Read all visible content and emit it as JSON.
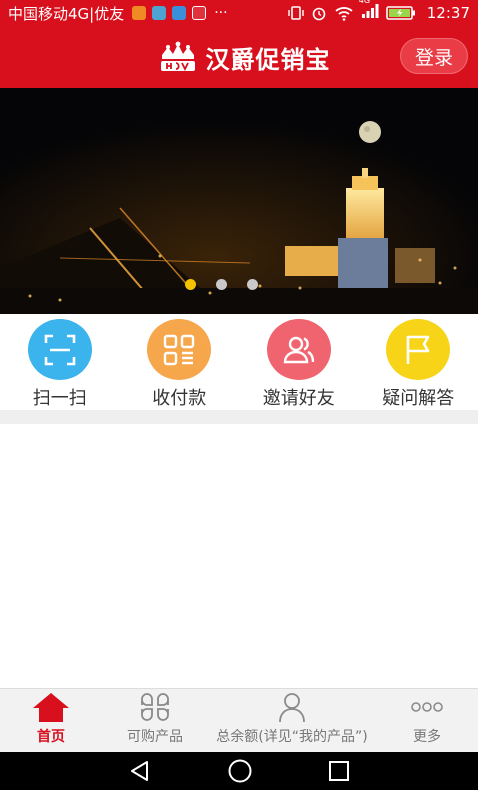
{
  "status_bar": {
    "carrier": "中国移动4G|优友",
    "overflow": "···",
    "network_type": "4G",
    "time": "12:37"
  },
  "header": {
    "title": "汉爵促销宝",
    "login_label": "登录",
    "brand_color": "#d8101d"
  },
  "banner": {
    "slide_count": 3,
    "active_slide": 1
  },
  "quick_actions": [
    {
      "label": "扫一扫",
      "icon": "scan-icon",
      "color": "#3bb3ec"
    },
    {
      "label": "收付款",
      "icon": "qr-code-icon",
      "color": "#f6a64b"
    },
    {
      "label": "邀请好友",
      "icon": "users-icon",
      "color": "#f06470"
    },
    {
      "label": "疑问解答",
      "icon": "flag-icon",
      "color": "#f7d417"
    }
  ],
  "tabs": [
    {
      "label": "首页",
      "icon": "home-icon",
      "active": true
    },
    {
      "label": "可购产品",
      "icon": "grid-icon",
      "active": false
    },
    {
      "label": "总余额(详见“我的产品”)",
      "icon": "person-icon",
      "active": false
    },
    {
      "label": "更多",
      "icon": "more-icon",
      "active": false
    }
  ]
}
